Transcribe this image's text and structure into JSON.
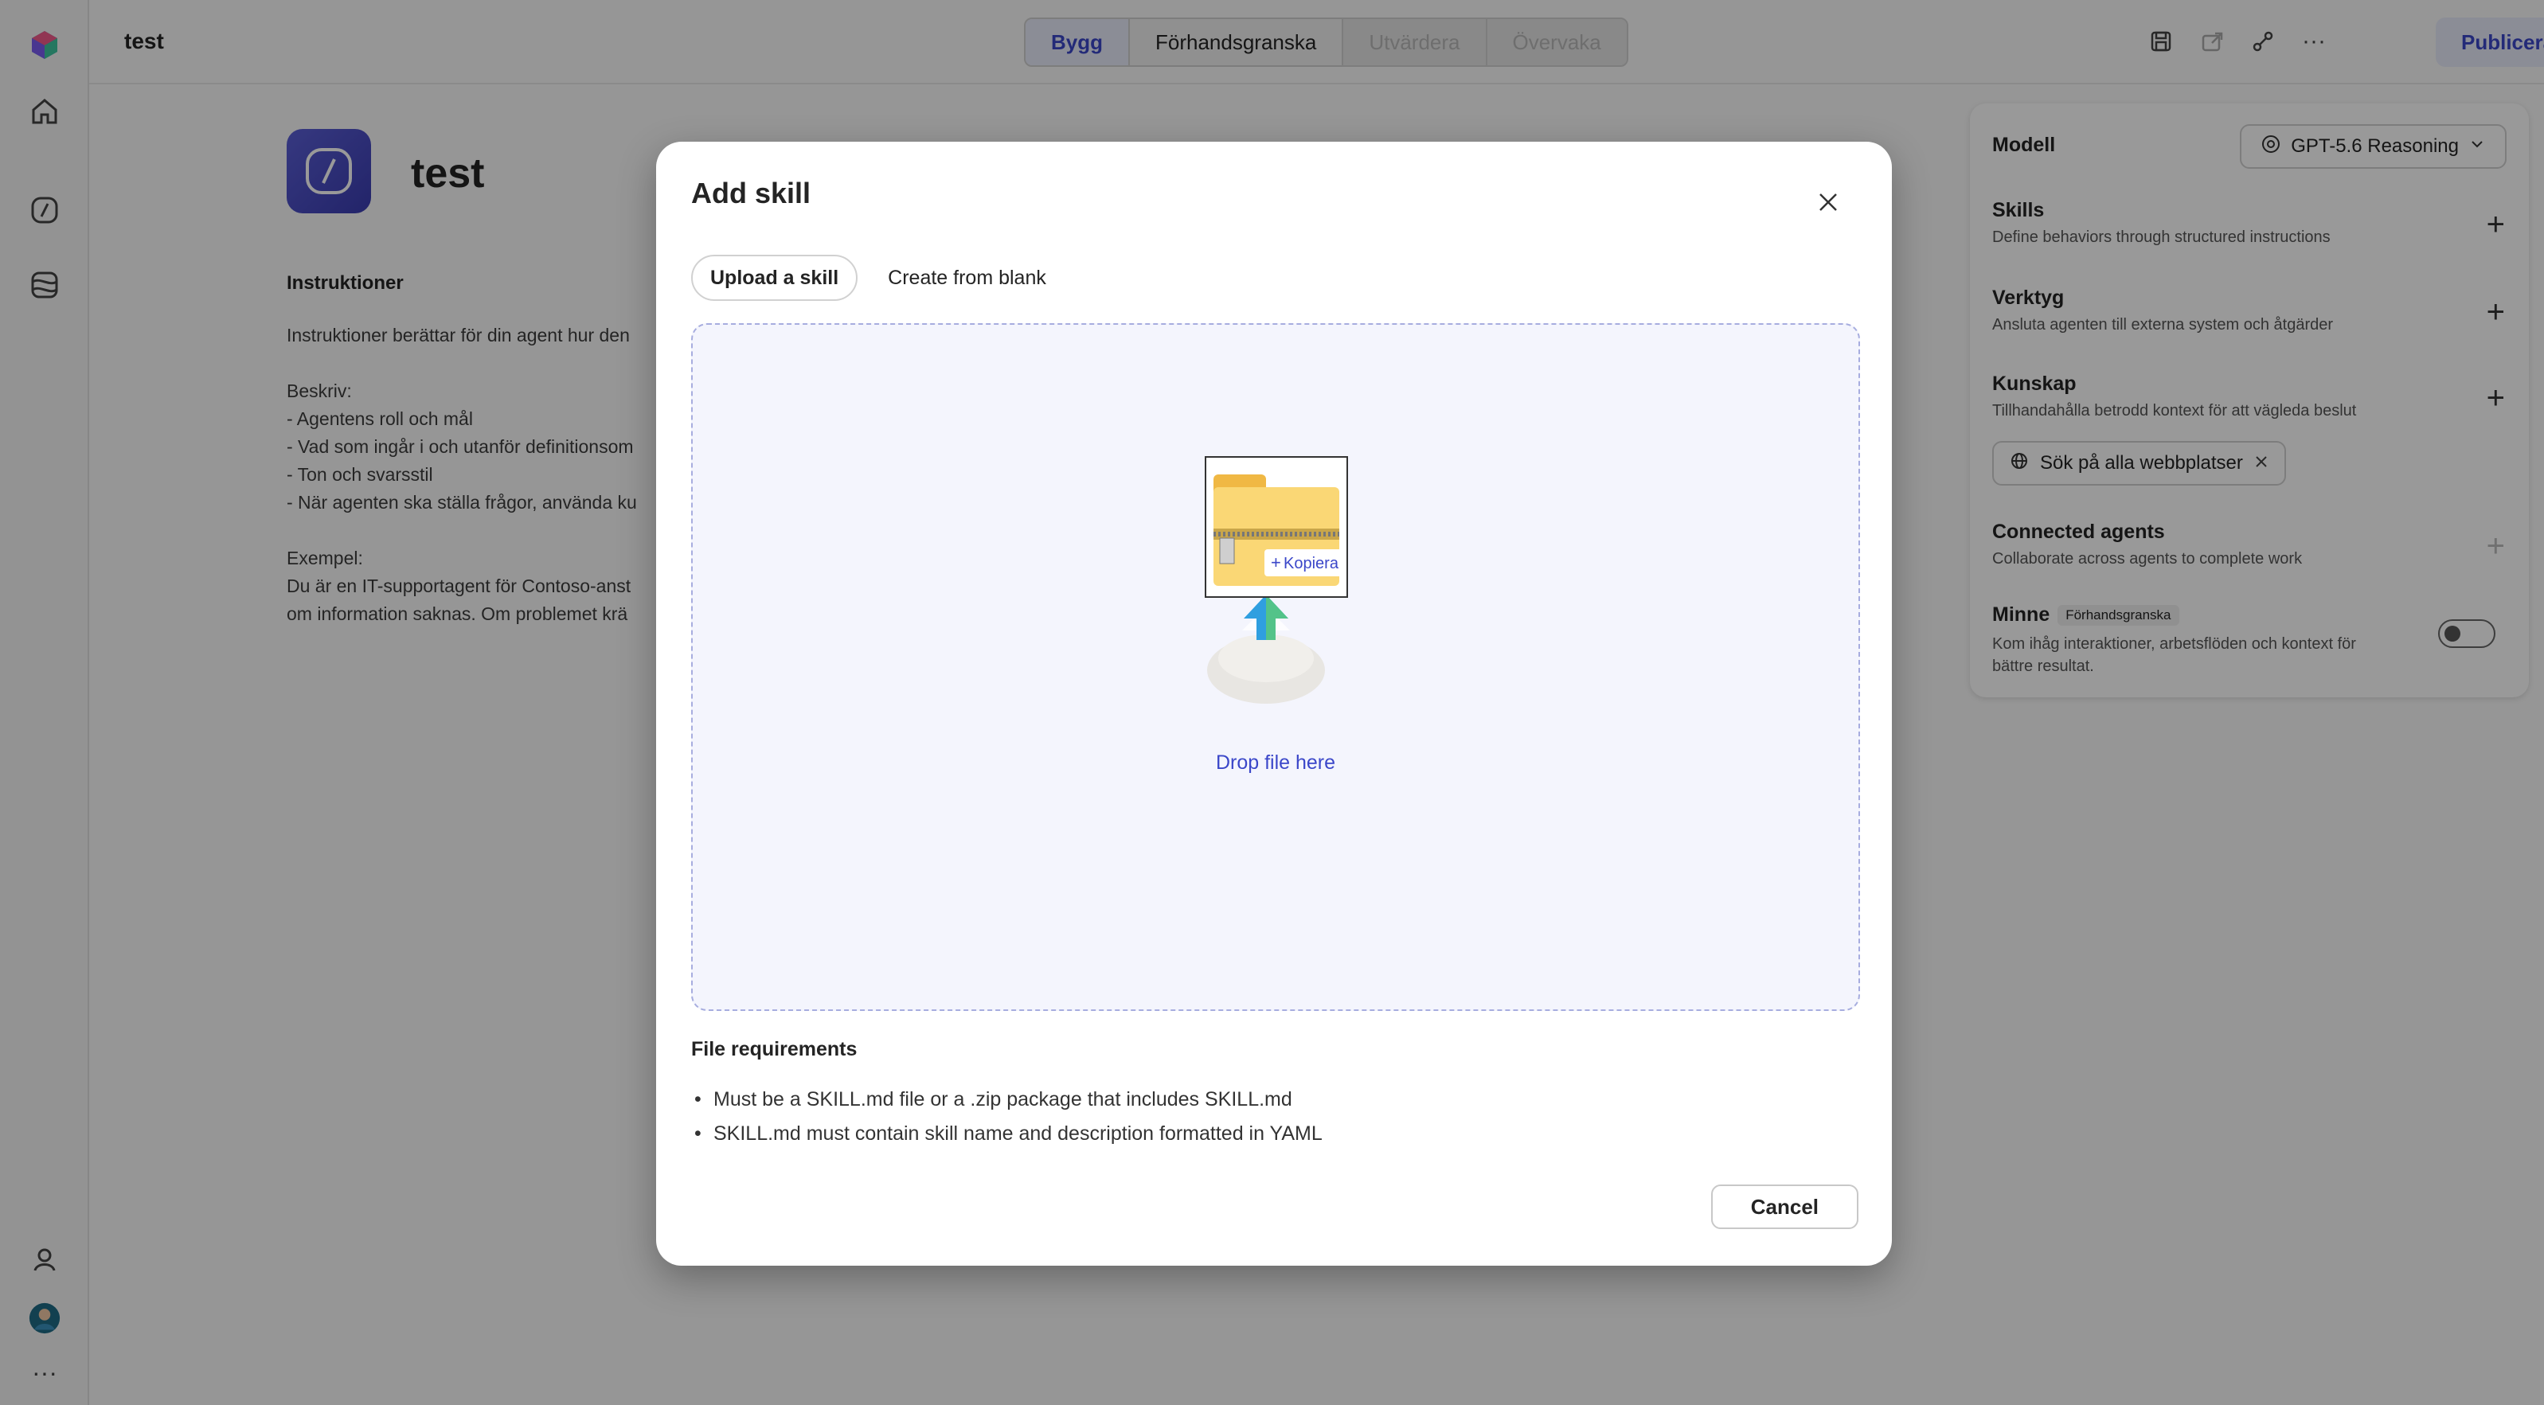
{
  "header": {
    "title": "test",
    "tabs": [
      {
        "label": "Bygg",
        "state": "active"
      },
      {
        "label": "Förhandsgranska",
        "state": "normal"
      },
      {
        "label": "Utvärdera",
        "state": "disabled"
      },
      {
        "label": "Övervaka",
        "state": "disabled"
      }
    ],
    "publish_label": "Publicera"
  },
  "agent": {
    "name": "test",
    "instructions_heading": "Instruktioner",
    "instructions_text": "Instruktioner berättar för din agent hur den\n\nBeskriv:\n- Agentens roll och mål\n- Vad som ingår i och utanför definitionsom\n- Ton och svarsstil\n- När agenten ska ställa frågor, använda ku\n\nExempel:\nDu är en IT-supportagent för Contoso-anst\nom information saknas. Om problemet krä"
  },
  "panel": {
    "model_label": "Modell",
    "model_value": "GPT-5.6 Reasoning",
    "skills_title": "Skills",
    "skills_desc": "Define behaviors through structured instructions",
    "tools_title": "Verktyg",
    "tools_desc": "Ansluta agenten till externa system och åtgärder",
    "knowledge_title": "Kunskap",
    "knowledge_desc": "Tillhandahålla betrodd kontext för att vägleda beslut",
    "knowledge_chip": "Sök på alla webbplatser",
    "connected_title": "Connected agents",
    "connected_desc": "Collaborate across agents to complete work",
    "memory_title": "Minne",
    "memory_badge": "Förhandsgranska",
    "memory_desc_1": "Kom ihåg interaktioner, arbetsflöden och kontext för",
    "memory_desc_2": "bättre resultat."
  },
  "dialog": {
    "title": "Add skill",
    "tab_upload": "Upload a skill",
    "tab_blank": "Create from blank",
    "copy_label": "Kopiera",
    "drop_text": "Drop file here",
    "requirements_heading": "File requirements",
    "requirements": [
      "Must be a SKILL.md file or a .zip package that includes SKILL.md",
      "SKILL.md must contain skill name and description formatted in YAML"
    ],
    "cancel_label": "Cancel"
  },
  "colors": {
    "accent": "#3b47c9",
    "agent_avatar": "#4f52c8"
  }
}
